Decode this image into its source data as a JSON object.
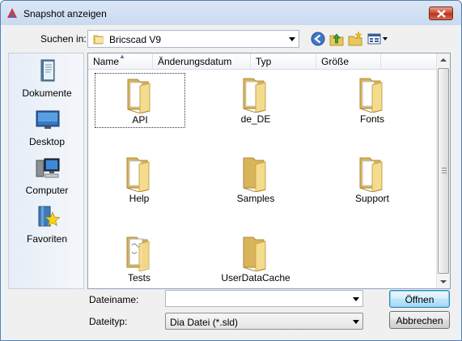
{
  "window": {
    "title": "Snapshot anzeigen"
  },
  "toolbar": {
    "look_in_label": "Suchen in:",
    "look_in_value": "Bricscad V9",
    "icons": [
      "back-icon",
      "up-folder-icon",
      "new-folder-icon",
      "views-icon"
    ]
  },
  "places": [
    {
      "label": "Dokumente",
      "icon": "documents-icon"
    },
    {
      "label": "Desktop",
      "icon": "desktop-icon"
    },
    {
      "label": "Computer",
      "icon": "computer-icon"
    },
    {
      "label": "Favoriten",
      "icon": "favorites-icon"
    }
  ],
  "columns": [
    "Name",
    "Änderungsdatum",
    "Typ",
    "Größe"
  ],
  "files": [
    {
      "name": "API",
      "type": "folder",
      "selected": true
    },
    {
      "name": "de_DE",
      "type": "folder"
    },
    {
      "name": "Fonts",
      "type": "folder"
    },
    {
      "name": "Help",
      "type": "folder"
    },
    {
      "name": "Samples",
      "type": "folder"
    },
    {
      "name": "Support",
      "type": "folder"
    },
    {
      "name": "Tests",
      "type": "folder-docs"
    },
    {
      "name": "UserDataCache",
      "type": "folder"
    }
  ],
  "footer": {
    "filename_label": "Dateiname:",
    "filename_value": "",
    "filetype_label": "Dateityp:",
    "filetype_value": "Dia Datei (*.sld)",
    "open_label": "Öffnen",
    "cancel_label": "Abbrechen"
  },
  "colors": {
    "titlebar": "#c9daf0",
    "close_button": "#c7452a",
    "folder": "#f1d67a",
    "selection_border": "#333333"
  }
}
